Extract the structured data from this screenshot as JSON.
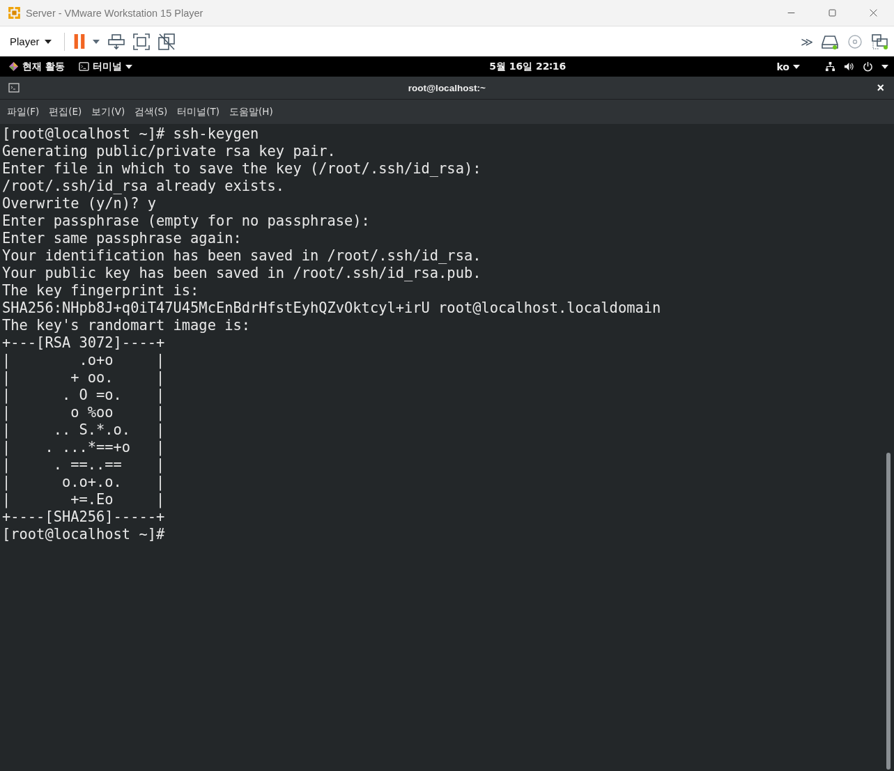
{
  "window": {
    "title": "Server - VMware Workstation 15 Player"
  },
  "toolbar": {
    "player_menu": "Player",
    "more": "≫"
  },
  "top_bar": {
    "activities": "현재 활동",
    "app_menu": "터미널",
    "clock": "5월 16일 22∶16",
    "input_source": "ko"
  },
  "terminal": {
    "title": "root@localhost:~",
    "close": "×",
    "menu": [
      "파일(F)",
      "편집(E)",
      "보기(V)",
      "검색(S)",
      "터미널(T)",
      "도움말(H)"
    ],
    "lines": [
      "[root@localhost ~]# ssh-keygen",
      "Generating public/private rsa key pair.",
      "Enter file in which to save the key (/root/.ssh/id_rsa):",
      "/root/.ssh/id_rsa already exists.",
      "Overwrite (y/n)? y",
      "Enter passphrase (empty for no passphrase):",
      "Enter same passphrase again:",
      "Your identification has been saved in /root/.ssh/id_rsa.",
      "Your public key has been saved in /root/.ssh/id_rsa.pub.",
      "The key fingerprint is:",
      "SHA256:NHpb8J+q0iT47U45McEnBdrHfstEyhQZvOktcyl+irU root@localhost.localdomain",
      "The key's randomart image is:",
      "+---[RSA 3072]----+",
      "|        .o+o     |",
      "|       + oo.     |",
      "|      . O =o.    |",
      "|       o %oo     |",
      "|     .. S.*.o.   |",
      "|    . ...*==+o   |",
      "|     . ==..==    |",
      "|      o.o+.o.    |",
      "|       +=.Eo     |",
      "+----[SHA256]-----+",
      "[root@localhost ~]#"
    ]
  }
}
